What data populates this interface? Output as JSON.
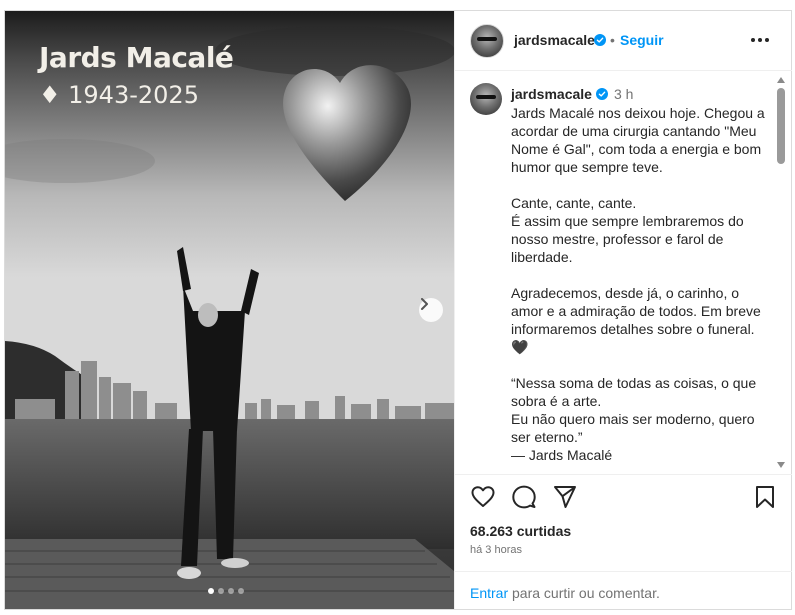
{
  "photo": {
    "title": "Jards Macalé",
    "years": "♦ 1943-2025",
    "carousel_total": 4,
    "carousel_active": 1
  },
  "header": {
    "username": "jardsmacale",
    "separator": "•",
    "follow_label": "Seguir"
  },
  "caption": {
    "username": "jardsmacale",
    "time": "3 h",
    "paragraphs": [
      "Jards Macalé nos deixou hoje. Chegou a acordar de uma cirurgia cantando \"Meu Nome é Gal\", com toda a energia e bom humor que sempre teve.",
      "Cante, cante, cante.",
      "É assim que sempre lembraremos do nosso mestre, professor e farol de liberdade.",
      "Agradecemos, desde já, o carinho, o amor e a admiração de todos. Em breve informaremos detalhes sobre o funeral.",
      "🖤",
      "“Nessa soma de todas as coisas, o que sobra é a arte.",
      "Eu não quero mais ser moderno, quero ser eterno.”",
      "— Jards Macalé"
    ]
  },
  "stats": {
    "likes": "68.263 curtidas",
    "time_ago": "há 3 horas"
  },
  "login": {
    "link": "Entrar",
    "rest": " para curtir ou comentar."
  },
  "colors": {
    "accent": "#0095f6",
    "verified": "#0095f6",
    "muted": "#737373"
  }
}
